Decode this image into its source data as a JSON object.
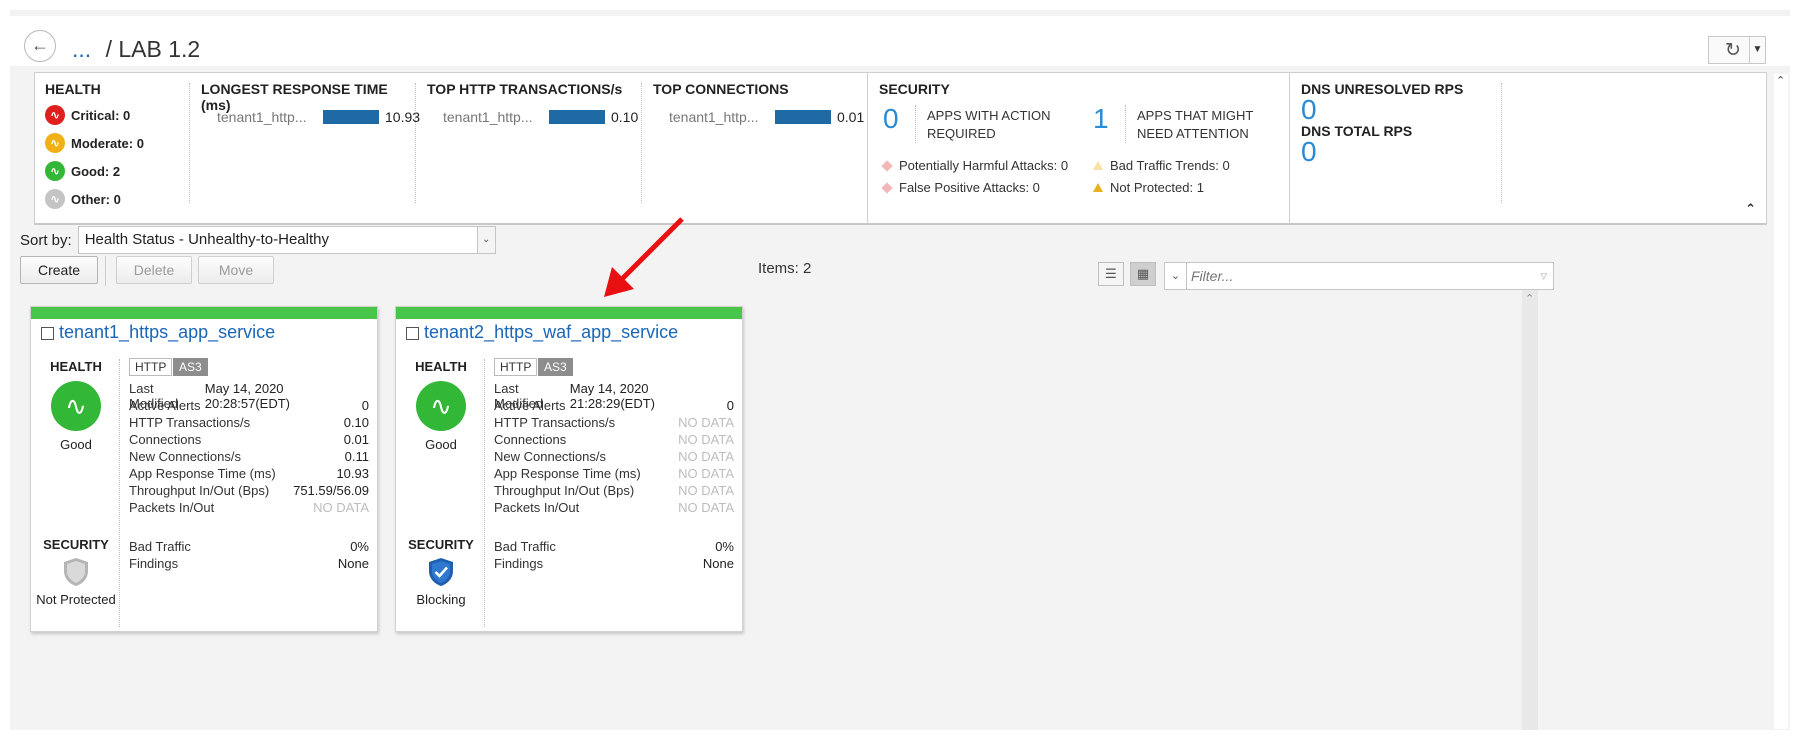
{
  "header": {
    "breadcrumb_ellipsis": "...",
    "breadcrumb_sep": "/",
    "title": "LAB 1.2"
  },
  "summary": {
    "health": {
      "title": "HEALTH",
      "items": [
        {
          "label": "Critical: 0",
          "color": "#e0201e"
        },
        {
          "label": "Moderate: 0",
          "color": "#f2b017"
        },
        {
          "label": "Good: 2",
          "color": "#33b737"
        },
        {
          "label": "Other: 0",
          "color": "#c4c4c4"
        }
      ]
    },
    "longest_response": {
      "title": "LONGEST RESPONSE TIME (ms)",
      "label": "tenant1_http...",
      "value": "10.93",
      "fill": 1.0
    },
    "top_http": {
      "title": "TOP HTTP TRANSACTIONS/s",
      "label": "tenant1_http...",
      "value": "0.10",
      "fill": 1.0
    },
    "top_conn": {
      "title": "TOP CONNECTIONS",
      "label": "tenant1_http...",
      "value": "0.01",
      "fill": 1.0
    },
    "security": {
      "title": "SECURITY",
      "action_required_count": "0",
      "action_required_label": "APPS WITH ACTION REQUIRED",
      "attention_count": "1",
      "attention_label": "APPS THAT MIGHT NEED ATTENTION",
      "harmful": "Potentially Harmful Attacks: 0",
      "false_positive": "False Positive Attacks: 0",
      "bad_traffic": "Bad Traffic Trends: 0",
      "not_protected": "Not Protected: 1"
    },
    "dns": {
      "unresolved_title": "DNS UNRESOLVED RPS",
      "unresolved_value": "0",
      "total_title": "DNS TOTAL RPS",
      "total_value": "0"
    }
  },
  "toolbar": {
    "sort_label": "Sort by:",
    "sort_value": "Health Status - Unhealthy-to-Healthy",
    "create": "Create",
    "delete": "Delete",
    "move": "Move",
    "items_label": "Items: 2",
    "filter_placeholder": "Filter..."
  },
  "cards": [
    {
      "name": "tenant1_https_app_service",
      "health_label": "HEALTH",
      "health_status": "Good",
      "tags": [
        "HTTP",
        "AS3"
      ],
      "metrics": [
        {
          "k": "Last Modified",
          "v": "May 14, 2020 20:28:57(EDT)"
        },
        {
          "k": "Active Alerts",
          "v": "0"
        },
        {
          "k": "HTTP Transactions/s",
          "v": "0.10"
        },
        {
          "k": "Connections",
          "v": "0.01"
        },
        {
          "k": "New Connections/s",
          "v": "0.11"
        },
        {
          "k": "App Response Time (ms)",
          "v": "10.93"
        },
        {
          "k": "Throughput In/Out (Bps)",
          "v": "751.59/56.09"
        },
        {
          "k": "Packets In/Out",
          "v": "NO DATA"
        }
      ],
      "security_label": "SECURITY",
      "security_metrics": [
        {
          "k": "Bad Traffic",
          "v": "0%"
        },
        {
          "k": "Findings",
          "v": "None"
        }
      ],
      "security_status": "Not Protected",
      "shield_color": "#b5b5b5"
    },
    {
      "name": "tenant2_https_waf_app_service",
      "health_label": "HEALTH",
      "health_status": "Good",
      "tags": [
        "HTTP",
        "AS3"
      ],
      "metrics": [
        {
          "k": "Last Modified",
          "v": "May 14, 2020 21:28:29(EDT)"
        },
        {
          "k": "Active Alerts",
          "v": "0"
        },
        {
          "k": "HTTP Transactions/s",
          "v": "NO DATA"
        },
        {
          "k": "Connections",
          "v": "NO DATA"
        },
        {
          "k": "New Connections/s",
          "v": "NO DATA"
        },
        {
          "k": "App Response Time (ms)",
          "v": "NO DATA"
        },
        {
          "k": "Throughput In/Out (Bps)",
          "v": "NO DATA"
        },
        {
          "k": "Packets In/Out",
          "v": "NO DATA"
        }
      ],
      "security_label": "SECURITY",
      "security_metrics": [
        {
          "k": "Bad Traffic",
          "v": "0%"
        },
        {
          "k": "Findings",
          "v": "None"
        }
      ],
      "security_status": "Blocking",
      "shield_color": "#1f5fb0"
    }
  ],
  "colors": {
    "accent": "#1a66b8",
    "good": "#33b737",
    "bar": "#1f6aa5",
    "arrow": "#e81010"
  }
}
